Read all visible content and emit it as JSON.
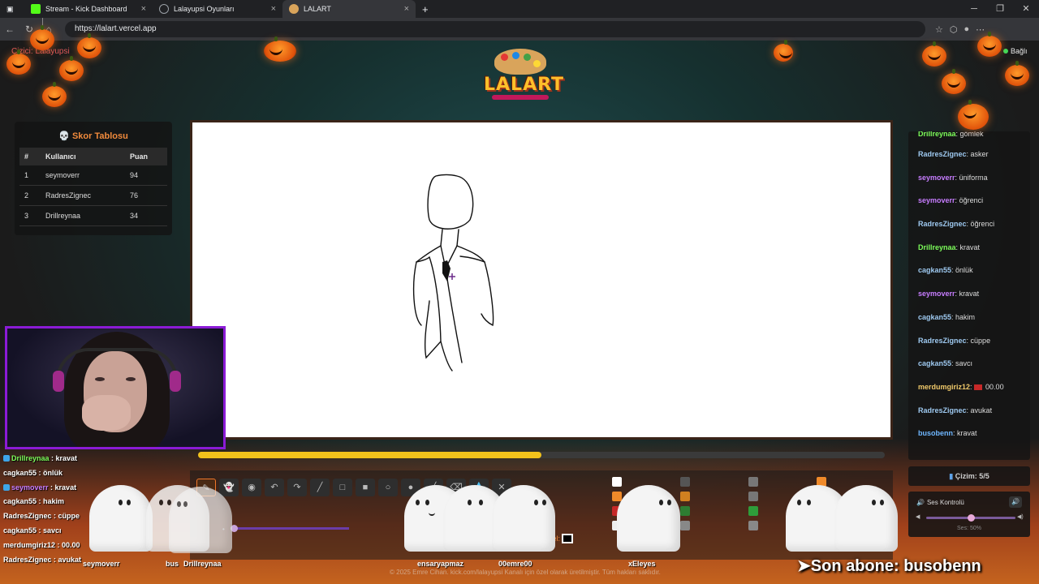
{
  "browser": {
    "tabs": [
      {
        "label": "Stream - Kick Dashboard",
        "icon": "kick-icon",
        "color": "#53fc18"
      },
      {
        "label": "Lalayupsi Oyunları",
        "icon": "globe-icon",
        "color": "#9aa0a6"
      },
      {
        "label": "LALART",
        "icon": "palette-icon",
        "color": "#d9a45b"
      }
    ],
    "url": "https://lalart.vercel.app"
  },
  "game": {
    "logo": "LALART",
    "player_label": "Çizici: Lalayupsi",
    "connection": "Bağlı"
  },
  "scoreboard": {
    "title": "💀 Skor Tablosu",
    "headers": [
      "#",
      "Kullanıcı",
      "Puan"
    ],
    "rows": [
      {
        "rank": "1",
        "user": "seymoverr",
        "score": "94"
      },
      {
        "rank": "2",
        "user": "RadresZignec",
        "score": "76"
      },
      {
        "rank": "3",
        "user": "Drillreynaa",
        "score": "34"
      }
    ]
  },
  "timer": {
    "progress": 0.5
  },
  "toolbar": {
    "custom_color_label": "Özel:",
    "tools": [
      "pencil-icon",
      "ghost-icon",
      "fill-icon",
      "undo-icon",
      "redo-icon",
      "brush-icon",
      "square-icon",
      "filled-square-icon",
      "circle-icon",
      "filled-circle-icon",
      "line-icon",
      "eraser-icon",
      "drop-icon",
      "clear-icon"
    ],
    "colors": [
      "#ffffff",
      "#555555",
      "#777777",
      "#f08a2a",
      "#f08a2a",
      "#d08020",
      "#777777",
      "#5a1aa8",
      "#c62828",
      "#2e7d32",
      "#2e9d3a",
      "#eeeeee",
      "#eeeeee",
      "#888888",
      "#888888",
      "#aaaaaa"
    ]
  },
  "right_chat": {
    "messages": [
      {
        "user": "Drillreynaa",
        "text": "gömlek",
        "color": "#7cfc5a"
      },
      {
        "user": "RadresZignec",
        "text": "asker",
        "color": "#9ec9f0"
      },
      {
        "user": "seymoverr",
        "text": "üniforma",
        "color": "#c77dff"
      },
      {
        "user": "seymoverr",
        "text": "öğrenci",
        "color": "#c77dff"
      },
      {
        "user": "RadresZignec",
        "text": "öğrenci",
        "color": "#9ec9f0"
      },
      {
        "user": "Drillreynaa",
        "text": "kravat",
        "color": "#7cfc5a"
      },
      {
        "user": "cagkan55",
        "text": "önlük",
        "color": "#9ec9f0"
      },
      {
        "user": "seymoverr",
        "text": "kravat",
        "color": "#c77dff"
      },
      {
        "user": "cagkan55",
        "text": "hakim",
        "color": "#9ec9f0"
      },
      {
        "user": "RadresZignec",
        "text": "cüppe",
        "color": "#9ec9f0"
      },
      {
        "user": "cagkan55",
        "text": "savcı",
        "color": "#9ec9f0"
      },
      {
        "user": "merdumgiriz12",
        "text": "00.00",
        "color": "#f0c96a",
        "flag": true
      },
      {
        "user": "RadresZignec",
        "text": "avukat",
        "color": "#9ec9f0"
      },
      {
        "user": "busobenn",
        "text": "kravat",
        "color": "#6fb7ff"
      }
    ]
  },
  "draw_count": {
    "label": "Çizim: 5/5"
  },
  "sound": {
    "title": "Ses Kontrolü",
    "value_label": "Ses: 50%",
    "volume": 0.5
  },
  "stream_chat": [
    {
      "user": "Drillreynaa",
      "text": " : kravat",
      "color": "#7cfc5a",
      "badge": true
    },
    {
      "user": "cagkan55",
      "text": " : önlük",
      "color": "#ffffff"
    },
    {
      "user": "seymoverr",
      "text": " : kravat",
      "color": "#c77dff",
      "badge": true
    },
    {
      "user": "cagkan55",
      "text": " : hakim",
      "color": "#ffffff"
    },
    {
      "user": "RadresZignec",
      "text": " : cüppe",
      "color": "#ffffff"
    },
    {
      "user": "cagkan55",
      "text": " : savcı",
      "color": "#ffffff"
    },
    {
      "user": "merdumgiriz12",
      "text": " :   00.00",
      "color": "#ffffff"
    },
    {
      "user": "RadresZignec",
      "text": " : avukat",
      "color": "#ffffff"
    }
  ],
  "player_names": [
    "seymoverr",
    "bus",
    "Drillreynaa",
    "ensaryapmaz",
    "00emre00",
    "xEleyes"
  ],
  "footer": "© 2025 Emre Cihan. kick.com/lalayupsi Kanalı için özel olarak üretilmiştir. Tüm hakları saklıdır.",
  "subscriber_alert": "➤Son abone: busobenn"
}
